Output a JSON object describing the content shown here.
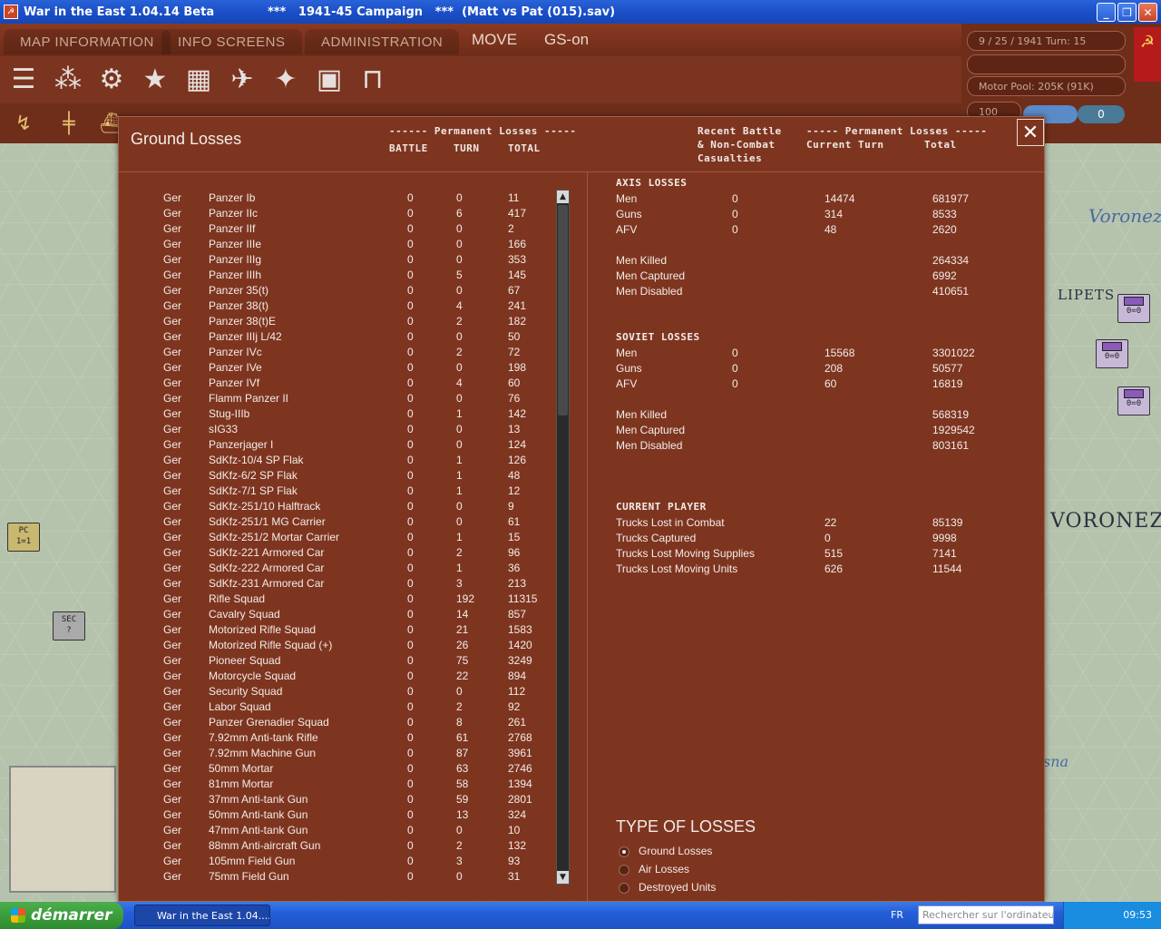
{
  "window": {
    "title": "War in the East 1.04.14 Beta             ***   1941-45 Campaign   ***  (Matt vs Pat (015).sav)",
    "minimize": "_",
    "maximize": "❐",
    "close": "✕"
  },
  "menu": {
    "map_information": "MAP INFORMATION",
    "info_screens": "INFO SCREENS",
    "administration": "ADMINISTRATION",
    "mode": "MOVE",
    "gs": "GS-on"
  },
  "status": {
    "date_turn": "9 / 25 / 1941       Turn: 15",
    "motor_pool": "Motor Pool:  205K (91K)",
    "zoom": "100",
    "pill_right": "0"
  },
  "map": {
    "label_voronezh": "Voronezh",
    "label_voronezh_caps": "VORONEZ",
    "label_lipetsk": "LIPETS",
    "label_sna": "sna",
    "counter_pc": "PC",
    "counter_pc_value": "1=1",
    "counter_sec": "SEC",
    "counter_sec_value": "?",
    "counter_value": "0=0"
  },
  "dialog": {
    "title": "Ground Losses",
    "left_header_group": "------ Permanent Losses -----",
    "col_battle": "BATTLE",
    "col_turn": "TURN",
    "col_total": "TOTAL",
    "right_header_recent": "Recent Battle\n& Non-Combat\nCasualties",
    "right_header_group": "----- Permanent Losses -----",
    "right_col_current": "Current Turn",
    "right_col_total": "Total",
    "close": "✕"
  },
  "losses": [
    {
      "nat": "Ger",
      "name": "Panzer Ib",
      "battle": "0",
      "turn": "0",
      "total": "11"
    },
    {
      "nat": "Ger",
      "name": "Panzer IIc",
      "battle": "0",
      "turn": "6",
      "total": "417"
    },
    {
      "nat": "Ger",
      "name": "Panzer IIf",
      "battle": "0",
      "turn": "0",
      "total": "2"
    },
    {
      "nat": "Ger",
      "name": "Panzer IIIe",
      "battle": "0",
      "turn": "0",
      "total": "166"
    },
    {
      "nat": "Ger",
      "name": "Panzer IIIg",
      "battle": "0",
      "turn": "0",
      "total": "353"
    },
    {
      "nat": "Ger",
      "name": "Panzer IIIh",
      "battle": "0",
      "turn": "5",
      "total": "145"
    },
    {
      "nat": "Ger",
      "name": "Panzer 35(t)",
      "battle": "0",
      "turn": "0",
      "total": "67"
    },
    {
      "nat": "Ger",
      "name": "Panzer 38(t)",
      "battle": "0",
      "turn": "4",
      "total": "241"
    },
    {
      "nat": "Ger",
      "name": "Panzer 38(t)E",
      "battle": "0",
      "turn": "2",
      "total": "182"
    },
    {
      "nat": "Ger",
      "name": "Panzer IIIj L/42",
      "battle": "0",
      "turn": "0",
      "total": "50"
    },
    {
      "nat": "Ger",
      "name": "Panzer IVc",
      "battle": "0",
      "turn": "2",
      "total": "72"
    },
    {
      "nat": "Ger",
      "name": "Panzer IVe",
      "battle": "0",
      "turn": "0",
      "total": "198"
    },
    {
      "nat": "Ger",
      "name": "Panzer IVf",
      "battle": "0",
      "turn": "4",
      "total": "60"
    },
    {
      "nat": "Ger",
      "name": "Flamm Panzer II",
      "battle": "0",
      "turn": "0",
      "total": "76"
    },
    {
      "nat": "Ger",
      "name": "Stug-IIIb",
      "battle": "0",
      "turn": "1",
      "total": "142"
    },
    {
      "nat": "Ger",
      "name": "sIG33",
      "battle": "0",
      "turn": "0",
      "total": "13"
    },
    {
      "nat": "Ger",
      "name": "Panzerjager I",
      "battle": "0",
      "turn": "0",
      "total": "124"
    },
    {
      "nat": "Ger",
      "name": "SdKfz-10/4 SP Flak",
      "battle": "0",
      "turn": "1",
      "total": "126"
    },
    {
      "nat": "Ger",
      "name": "SdKfz-6/2 SP Flak",
      "battle": "0",
      "turn": "1",
      "total": "48"
    },
    {
      "nat": "Ger",
      "name": "SdKfz-7/1 SP Flak",
      "battle": "0",
      "turn": "1",
      "total": "12"
    },
    {
      "nat": "Ger",
      "name": "SdKfz-251/10 Halftrack",
      "battle": "0",
      "turn": "0",
      "total": "9"
    },
    {
      "nat": "Ger",
      "name": "SdKfz-251/1 MG Carrier",
      "battle": "0",
      "turn": "0",
      "total": "61"
    },
    {
      "nat": "Ger",
      "name": "SdKfz-251/2 Mortar Carrier",
      "battle": "0",
      "turn": "1",
      "total": "15"
    },
    {
      "nat": "Ger",
      "name": "SdKfz-221 Armored Car",
      "battle": "0",
      "turn": "2",
      "total": "96"
    },
    {
      "nat": "Ger",
      "name": "SdKfz-222 Armored Car",
      "battle": "0",
      "turn": "1",
      "total": "36"
    },
    {
      "nat": "Ger",
      "name": "SdKfz-231 Armored Car",
      "battle": "0",
      "turn": "3",
      "total": "213"
    },
    {
      "nat": "Ger",
      "name": "Rifle Squad",
      "battle": "0",
      "turn": "192",
      "total": "11315"
    },
    {
      "nat": "Ger",
      "name": "Cavalry Squad",
      "battle": "0",
      "turn": "14",
      "total": "857"
    },
    {
      "nat": "Ger",
      "name": "Motorized Rifle Squad",
      "battle": "0",
      "turn": "21",
      "total": "1583"
    },
    {
      "nat": "Ger",
      "name": "Motorized Rifle Squad (+)",
      "battle": "0",
      "turn": "26",
      "total": "1420"
    },
    {
      "nat": "Ger",
      "name": "Pioneer Squad",
      "battle": "0",
      "turn": "75",
      "total": "3249"
    },
    {
      "nat": "Ger",
      "name": "Motorcycle Squad",
      "battle": "0",
      "turn": "22",
      "total": "894"
    },
    {
      "nat": "Ger",
      "name": "Security Squad",
      "battle": "0",
      "turn": "0",
      "total": "112"
    },
    {
      "nat": "Ger",
      "name": "Labor Squad",
      "battle": "0",
      "turn": "2",
      "total": "92"
    },
    {
      "nat": "Ger",
      "name": "Panzer Grenadier Squad",
      "battle": "0",
      "turn": "8",
      "total": "261"
    },
    {
      "nat": "Ger",
      "name": "7.92mm Anti-tank Rifle",
      "battle": "0",
      "turn": "61",
      "total": "2768"
    },
    {
      "nat": "Ger",
      "name": "7.92mm Machine Gun",
      "battle": "0",
      "turn": "87",
      "total": "3961"
    },
    {
      "nat": "Ger",
      "name": "50mm Mortar",
      "battle": "0",
      "turn": "63",
      "total": "2746"
    },
    {
      "nat": "Ger",
      "name": "81mm Mortar",
      "battle": "0",
      "turn": "58",
      "total": "1394"
    },
    {
      "nat": "Ger",
      "name": "37mm Anti-tank Gun",
      "battle": "0",
      "turn": "59",
      "total": "2801"
    },
    {
      "nat": "Ger",
      "name": "50mm Anti-tank Gun",
      "battle": "0",
      "turn": "13",
      "total": "324"
    },
    {
      "nat": "Ger",
      "name": "47mm Anti-tank Gun",
      "battle": "0",
      "turn": "0",
      "total": "10"
    },
    {
      "nat": "Ger",
      "name": "88mm Anti-aircraft Gun",
      "battle": "0",
      "turn": "2",
      "total": "132"
    },
    {
      "nat": "Ger",
      "name": "105mm Field Gun",
      "battle": "0",
      "turn": "3",
      "total": "93"
    },
    {
      "nat": "Ger",
      "name": "75mm Field Gun",
      "battle": "0",
      "turn": "0",
      "total": "31"
    }
  ],
  "axis": {
    "title": "AXIS LOSSES",
    "men": {
      "label": "Men",
      "recent": "0",
      "turn": "14474",
      "total": "681977"
    },
    "guns": {
      "label": "Guns",
      "recent": "0",
      "turn": "314",
      "total": "8533"
    },
    "afv": {
      "label": "AFV",
      "recent": "0",
      "turn": "48",
      "total": "2620"
    },
    "killed": {
      "label": "Men Killed",
      "total": "264334"
    },
    "captured": {
      "label": "Men Captured",
      "total": "6992"
    },
    "disabled": {
      "label": "Men Disabled",
      "total": "410651"
    }
  },
  "soviet": {
    "title": "SOVIET LOSSES",
    "men": {
      "label": "Men",
      "recent": "0",
      "turn": "15568",
      "total": "3301022"
    },
    "guns": {
      "label": "Guns",
      "recent": "0",
      "turn": "208",
      "total": "50577"
    },
    "afv": {
      "label": "AFV",
      "recent": "0",
      "turn": "60",
      "total": "16819"
    },
    "killed": {
      "label": "Men Killed",
      "total": "568319"
    },
    "captured": {
      "label": "Men Captured",
      "total": "1929542"
    },
    "disabled": {
      "label": "Men Disabled",
      "total": "803161"
    }
  },
  "current_player": {
    "title": "CURRENT PLAYER",
    "combat": {
      "label": "Trucks Lost in Combat",
      "turn": "22",
      "total": "85139"
    },
    "captured": {
      "label": "Trucks Captured",
      "turn": "0",
      "total": "9998"
    },
    "supplies": {
      "label": "Trucks Lost Moving Supplies",
      "turn": "515",
      "total": "7141"
    },
    "units": {
      "label": "Trucks Lost Moving Units",
      "turn": "626",
      "total": "11544"
    }
  },
  "type_of_losses": {
    "title": "TYPE OF LOSSES",
    "ground": "Ground Losses",
    "air": "Air Losses",
    "destroyed": "Destroyed Units"
  },
  "taskbar": {
    "start": "démarrer",
    "task": "War in the East 1.04....",
    "lang": "FR",
    "search_placeholder": "Rechercher sur l'ordinateur",
    "clock": "09:53"
  }
}
